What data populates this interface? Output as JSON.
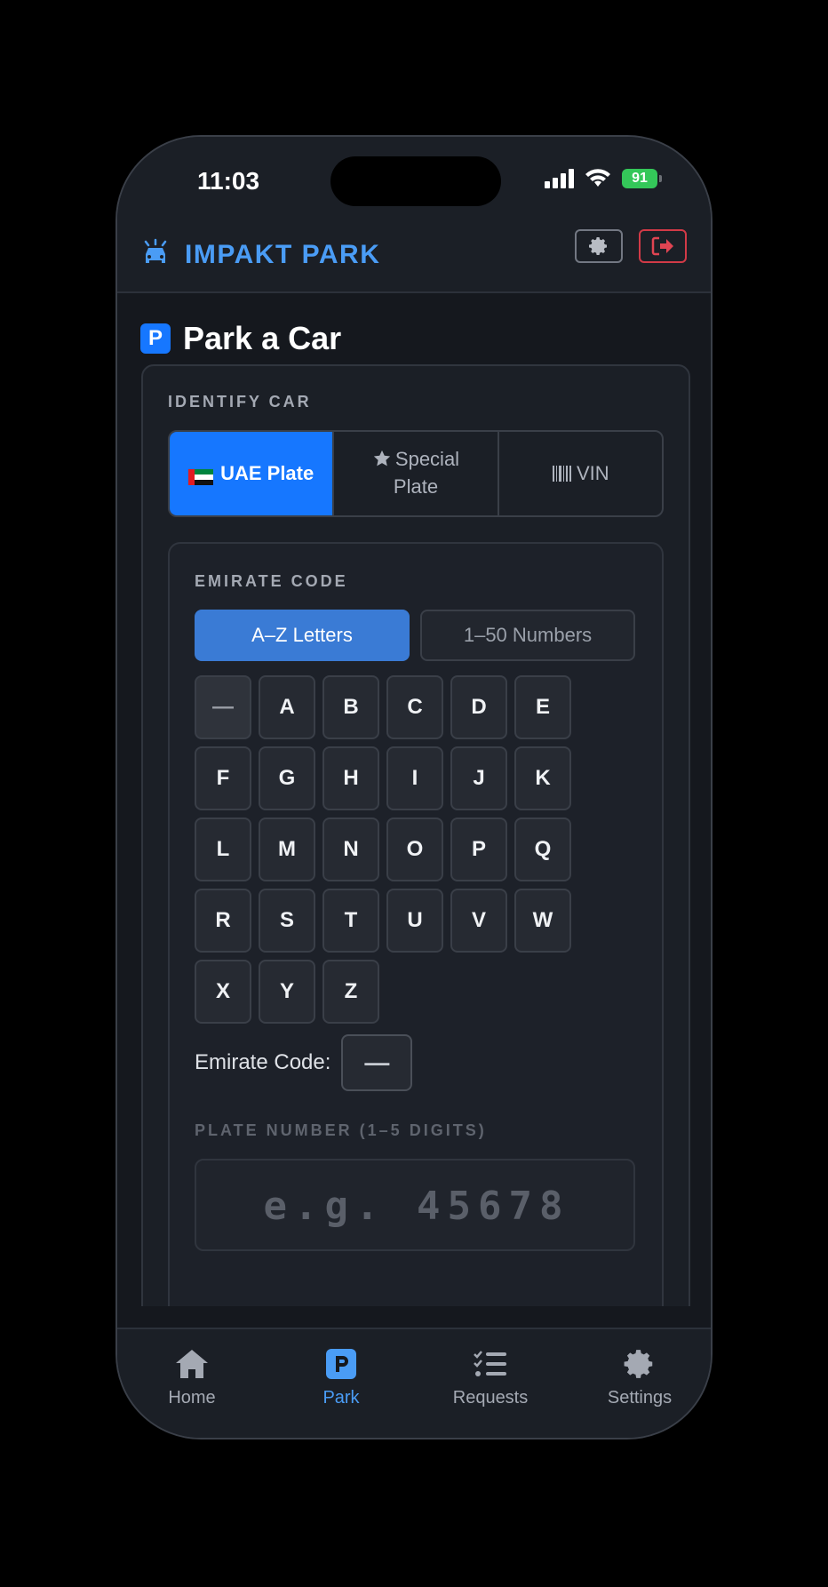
{
  "status": {
    "time": "11:03",
    "battery": "91"
  },
  "header": {
    "brand": "IMPAKT PARK"
  },
  "page": {
    "title": "Park a Car"
  },
  "identify": {
    "label": "IDENTIFY CAR",
    "options": [
      "UAE Plate",
      "Special Plate",
      "VIN"
    ],
    "selected": "UAE Plate"
  },
  "emirate": {
    "label": "EMIRATE CODE",
    "toggle_letters": "A–Z Letters",
    "toggle_numbers": "1–50 Numbers",
    "keys": [
      "—",
      "A",
      "B",
      "C",
      "D",
      "E",
      "F",
      "G",
      "H",
      "I",
      "J",
      "K",
      "L",
      "M",
      "N",
      "O",
      "P",
      "Q",
      "R",
      "S",
      "T",
      "U",
      "V",
      "W",
      "X",
      "Y",
      "Z"
    ],
    "code_label": "Emirate Code:",
    "code_value": "—"
  },
  "plate": {
    "label": "PLATE NUMBER (1–5 DIGITS)",
    "placeholder": "e.g. 45678"
  },
  "tabs": [
    {
      "label": "Home",
      "icon": "home-icon"
    },
    {
      "label": "Park",
      "icon": "parking-icon"
    },
    {
      "label": "Requests",
      "icon": "checklist-icon"
    },
    {
      "label": "Settings",
      "icon": "gear-icon"
    }
  ],
  "colors": {
    "accent": "#1677ff",
    "brand": "#4a9cf5",
    "danger": "#d23a47",
    "background": "#15181e"
  }
}
